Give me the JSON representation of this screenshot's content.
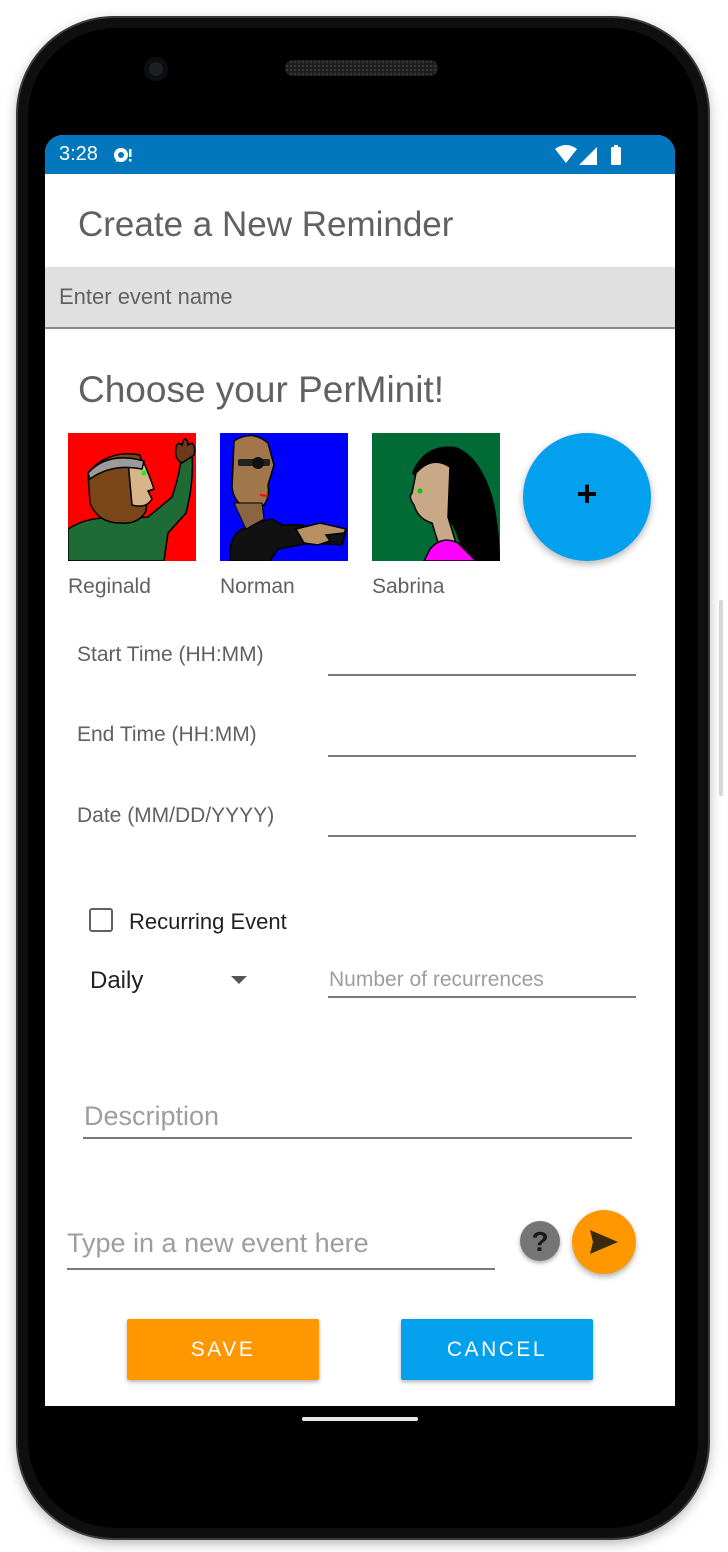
{
  "status_bar": {
    "time": "3:28",
    "color": "#0277bd",
    "icons": [
      "notification-icon",
      "wifi-icon",
      "signal-icon",
      "battery-icon"
    ]
  },
  "page": {
    "title": "Create a New Reminder",
    "event_name_placeholder": "Enter event name",
    "choose_title": "Choose your PerMinit!"
  },
  "characters": [
    {
      "name": "Reginald",
      "background": "#ff0000"
    },
    {
      "name": "Norman",
      "background": "#0000ff"
    },
    {
      "name": "Sabrina",
      "background": "#006b34"
    }
  ],
  "add_character_button": {
    "label": "+",
    "color": "#03a0ee"
  },
  "form": {
    "start_time_label": "Start Time (HH:MM)",
    "end_time_label": "End Time (HH:MM)",
    "date_label": "Date (MM/DD/YYYY)",
    "recurring_label": "Recurring Event",
    "recurring_checked": false,
    "frequency_value": "Daily",
    "recurrences_placeholder": "Number of recurrences",
    "description_placeholder": "Description"
  },
  "input_bar": {
    "placeholder": "Type in a new event here",
    "help_label": "?"
  },
  "buttons": {
    "save": "SAVE",
    "cancel": "CANCEL",
    "save_color": "#ff9800",
    "cancel_color": "#03a0ee"
  }
}
